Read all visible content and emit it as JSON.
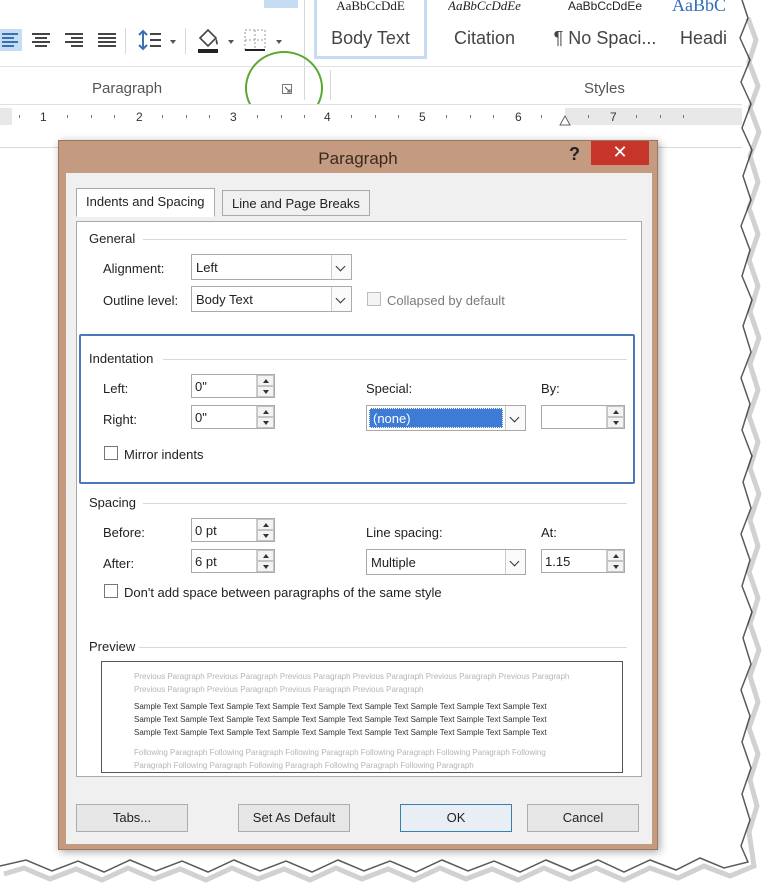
{
  "ribbon": {
    "paragraph_group_label": "Paragraph",
    "styles_group_label": "Styles",
    "dialog_launcher_icon": "dialog-launcher-icon",
    "styles": [
      {
        "sample": "AaBbCcDdE",
        "name": "Body Text"
      },
      {
        "sample": "AaBbCcDdEe",
        "name": "Citation"
      },
      {
        "sample": "AaBbCcDdEe",
        "name": "¶ No Spaci..."
      },
      {
        "sample": "AaBbC",
        "name": "Headi"
      }
    ]
  },
  "ruler": {
    "numbers": [
      "1",
      "2",
      "3",
      "4",
      "5",
      "6",
      "7"
    ]
  },
  "dialog": {
    "title": "Paragraph",
    "help": "?",
    "close": "✕",
    "tabs": [
      {
        "label": "Indents and Spacing"
      },
      {
        "label": "Line and Page Breaks"
      }
    ],
    "general": {
      "title": "General",
      "alignment_label": "Alignment:",
      "alignment_value": "Left",
      "outline_label": "Outline level:",
      "outline_value": "Body Text",
      "collapsed_label": "Collapsed by default"
    },
    "indentation": {
      "title": "Indentation",
      "left_label": "Left:",
      "left_value": "0\"",
      "right_label": "Right:",
      "right_value": "0\"",
      "special_label": "Special:",
      "special_value": "(none)",
      "by_label": "By:",
      "by_value": "",
      "mirror_label": "Mirror indents"
    },
    "spacing": {
      "title": "Spacing",
      "before_label": "Before:",
      "before_value": "0 pt",
      "after_label": "After:",
      "after_value": "6 pt",
      "line_spacing_label": "Line spacing:",
      "line_spacing_value": "Multiple",
      "at_label": "At:",
      "at_value": "1.15",
      "dont_add_label": "Don't add space between paragraphs of the same style"
    },
    "preview": {
      "title": "Preview",
      "previous": "Previous Paragraph Previous Paragraph Previous Paragraph Previous Paragraph Previous Paragraph Previous Paragraph Previous Paragraph Previous Paragraph Previous Paragraph Previous Paragraph",
      "sample": "Sample Text Sample Text Sample Text Sample Text Sample Text Sample Text Sample Text Sample Text Sample Text Sample Text Sample Text Sample Text Sample Text Sample Text Sample Text Sample Text Sample Text Sample Text Sample Text Sample Text Sample Text Sample Text Sample Text Sample Text Sample Text Sample Text Sample Text",
      "following": "Following Paragraph Following Paragraph Following Paragraph Following Paragraph Following Paragraph Following Paragraph Following Paragraph Following Paragraph Following Paragraph Following Paragraph"
    },
    "buttons": {
      "tabs": "Tabs...",
      "set_default": "Set As Default",
      "ok": "OK",
      "cancel": "Cancel"
    }
  },
  "colors": {
    "dialog_frame": "#c49a80",
    "close_button": "#c7342a",
    "highlight_box": "#4a78b8",
    "callout_circle": "#59a832",
    "selection": "#3d7bd4"
  }
}
